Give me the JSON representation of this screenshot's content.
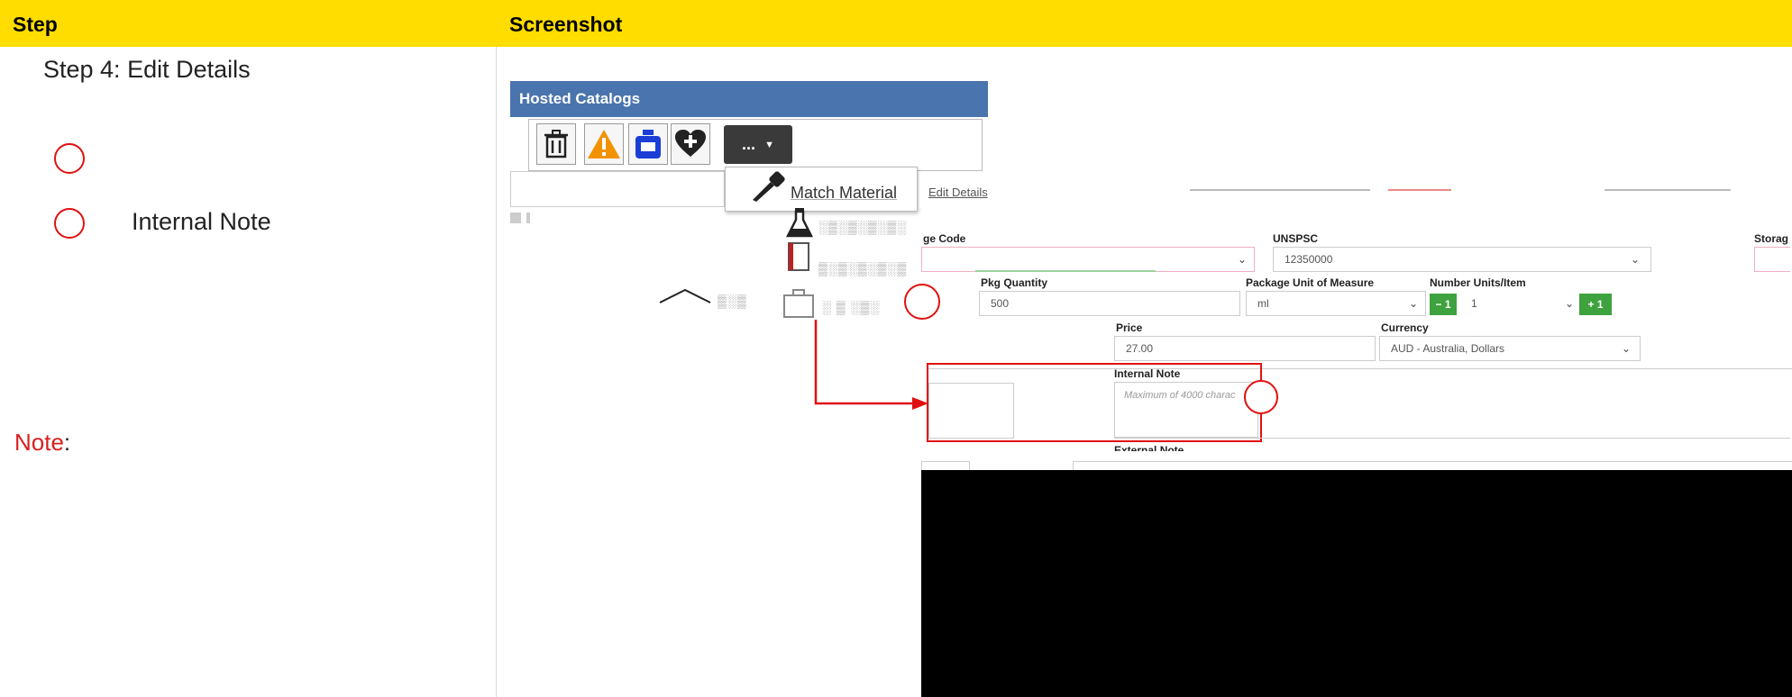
{
  "header": {
    "col_step": "Step",
    "col_screenshot": "Screenshot"
  },
  "step": {
    "title": "Step 4: Edit Details",
    "item_2": "Internal Note"
  },
  "note": {
    "label": "Note",
    "colon": ":"
  },
  "hosted_catalogs": {
    "title": "Hosted Catalogs",
    "toolbar_icons": [
      "trash-icon",
      "warning-icon",
      "bottle-icon",
      "heart-plus-icon"
    ],
    "more_button": "...",
    "menu_item": "Match Material"
  },
  "edit_details": {
    "tab_label": "Edit Details",
    "code_label": "ge Code",
    "unspsc_label": "UNSPSC",
    "unspsc_value": "12350000",
    "storage_label": "Storag",
    "pkg_quantity_label": "Pkg Quantity",
    "pkg_quantity_value": "500",
    "pkg_uom_label": "Package Unit of Measure",
    "pkg_uom_value": "ml",
    "units_label": "Number Units/Item",
    "units_minus": "− 1",
    "units_value": "1",
    "units_plus": "+ 1",
    "price_label": "Price",
    "price_value": "27.00",
    "currency_label": "Currency",
    "currency_value": "AUD - Australia, Dollars",
    "internal_note_label": "Internal Note",
    "internal_note_placeholder": "Maximum of 4000 charac",
    "external_note_label": "External Note"
  },
  "colors": {
    "header": "#ffdd00",
    "annotation": "#e01010",
    "title_bar": "#4a74ad",
    "green_button": "#3ea23e"
  }
}
